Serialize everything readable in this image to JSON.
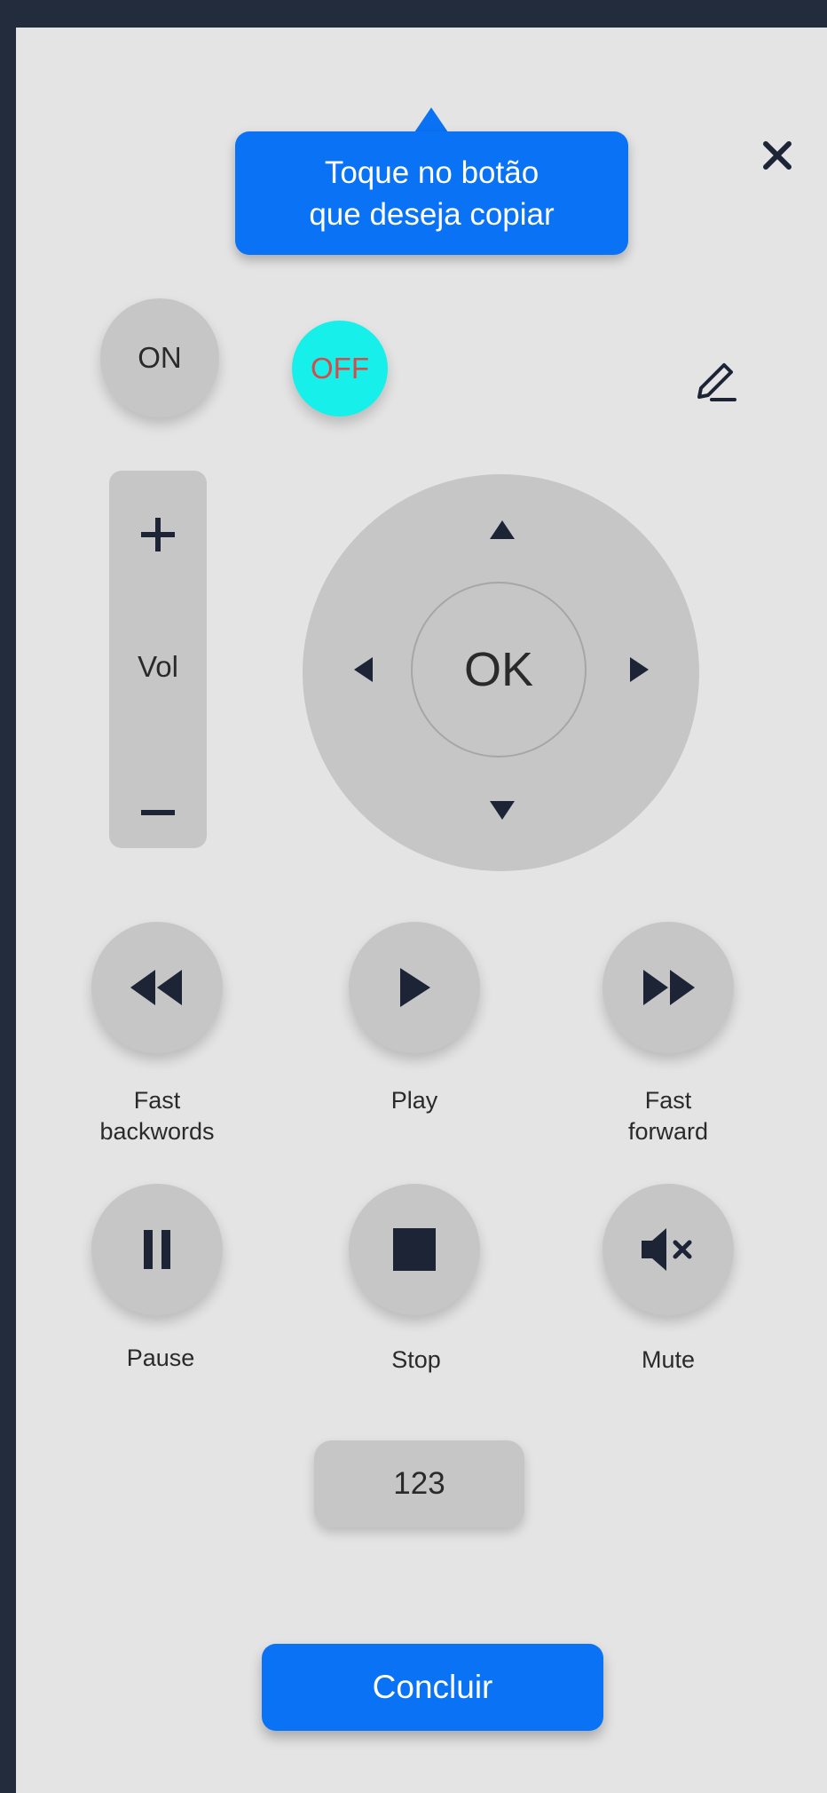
{
  "tooltip": {
    "line1": "Toque no botão",
    "line2": "que deseja copiar"
  },
  "power": {
    "on_label": "ON",
    "off_label": "OFF"
  },
  "volume": {
    "label": "Vol",
    "plus": "+",
    "minus": "–"
  },
  "dpad": {
    "ok_label": "OK"
  },
  "media": [
    {
      "label_line1": "Fast",
      "label_line2": "backwords"
    },
    {
      "label_line1": "Play",
      "label_line2": ""
    },
    {
      "label_line1": "Fast",
      "label_line2": "forward"
    },
    {
      "label_line1": "Pause",
      "label_line2": ""
    },
    {
      "label_line1": "Stop",
      "label_line2": ""
    },
    {
      "label_line1": "Mute",
      "label_line2": ""
    }
  ],
  "numbers_button": "123",
  "done_button": "Concluir",
  "icons": {
    "close": "close-icon",
    "edit": "pencil-icon",
    "up": "arrow-up-icon",
    "down": "arrow-down-icon",
    "left": "arrow-left-icon",
    "right": "arrow-right-icon"
  },
  "colors": {
    "accent": "#0a72f5",
    "off_button": "#17f0ea",
    "off_text": "#d74a4a",
    "frame": "#222c3d",
    "panel": "#e4e4e4",
    "button": "#c6c6c6",
    "icon": "#23304a"
  }
}
